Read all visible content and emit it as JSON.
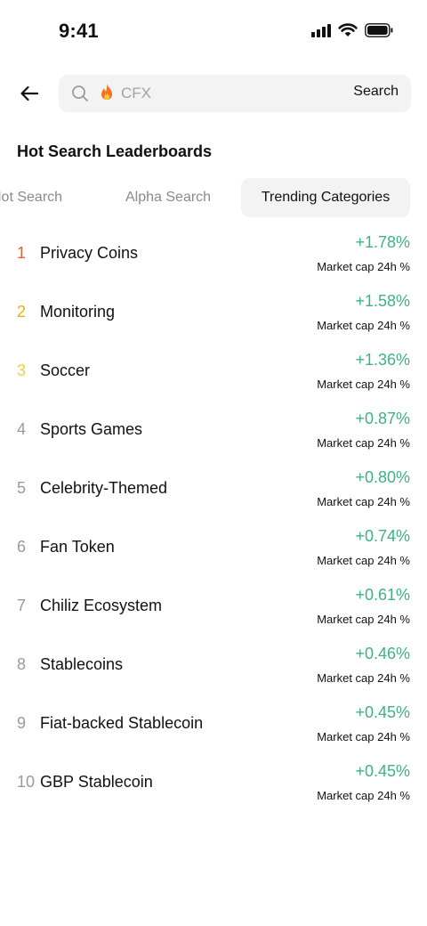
{
  "status_bar": {
    "time": "9:41",
    "icons": [
      "signal-icon",
      "wifi-icon",
      "battery-icon"
    ]
  },
  "search": {
    "back_icon": "back-arrow-icon",
    "search_icon": "magnifier-icon",
    "trend_icon": "fire-icon",
    "placeholder": "CFX",
    "value": "",
    "button_label": "Search"
  },
  "section": {
    "title": "Hot Search Leaderboards"
  },
  "tabs": [
    {
      "label": "Hot Search",
      "selected": false
    },
    {
      "label": "Alpha Search",
      "selected": false
    },
    {
      "label": "Trending Categories",
      "selected": true
    }
  ],
  "metric_label": "Market cap 24h %",
  "items": [
    {
      "rank": "1",
      "name": "Privacy Coins",
      "change": "+1.78%"
    },
    {
      "rank": "2",
      "name": "Monitoring",
      "change": "+1.58%"
    },
    {
      "rank": "3",
      "name": "Soccer",
      "change": "+1.36%"
    },
    {
      "rank": "4",
      "name": "Sports Games",
      "change": "+0.87%"
    },
    {
      "rank": "5",
      "name": "Celebrity-Themed",
      "change": "+0.80%"
    },
    {
      "rank": "6",
      "name": "Fan Token",
      "change": "+0.74%"
    },
    {
      "rank": "7",
      "name": "Chiliz Ecosystem",
      "change": "+0.61%"
    },
    {
      "rank": "8",
      "name": "Stablecoins",
      "change": "+0.46%"
    },
    {
      "rank": "9",
      "name": "Fiat-backed Stablecoin",
      "change": "+0.45%"
    },
    {
      "rank": "10",
      "name": "GBP Stablecoin",
      "change": "+0.45%"
    }
  ],
  "colors": {
    "positive": "#3fb283",
    "rank_1": "#e2603a",
    "rank_2": "#e5b318",
    "rank_3": "#ead147",
    "rank_other": "#9a9a9a",
    "chip_background": "#f3f3f3"
  }
}
